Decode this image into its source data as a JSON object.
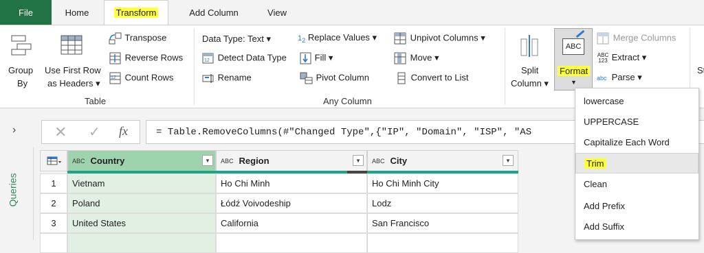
{
  "tabs": {
    "file": "File",
    "home": "Home",
    "transform": "Transform",
    "add_column": "Add Column",
    "view": "View"
  },
  "ribbon": {
    "table": {
      "group_by": [
        "Group",
        "By"
      ],
      "use_first_row": [
        "Use First Row",
        "as Headers"
      ],
      "transpose": "Transpose",
      "reverse_rows": "Reverse Rows",
      "count_rows": "Count Rows",
      "label": "Table"
    },
    "any_column": {
      "data_type": "Data Type: Text",
      "detect_data_type": "Detect Data Type",
      "rename": "Rename",
      "replace_values": "Replace Values",
      "fill": "Fill",
      "pivot_column": "Pivot Column",
      "unpivot_columns": "Unpivot Columns",
      "move": "Move",
      "convert_to_list": "Convert to List",
      "label": "Any Column"
    },
    "text_column": {
      "split_column": [
        "Split",
        "Column"
      ],
      "format": "Format",
      "format_icon_text": "ABC",
      "merge_columns": "Merge Columns",
      "extract": "Extract",
      "extract_icon_text": [
        "ABC",
        "123"
      ],
      "parse": "Parse",
      "parse_icon_text": "abc",
      "cut_off": "St"
    },
    "replace_sub": [
      "1",
      "2"
    ]
  },
  "queries_label": "Queries",
  "formula": {
    "fx": "fx",
    "expression": "= Table.RemoveColumns(#\"Changed Type\",{\"IP\", \"Domain\", \"ISP\", \"AS"
  },
  "grid": {
    "type_icon": "ABC",
    "columns": [
      "Country",
      "Region",
      "City"
    ],
    "rows": [
      {
        "num": "1",
        "cells": [
          "Vietnam",
          "Ho Chi Minh",
          "Ho Chi Minh City"
        ]
      },
      {
        "num": "2",
        "cells": [
          "Poland",
          "Łódź Voivodeship",
          "Lodz"
        ]
      },
      {
        "num": "3",
        "cells": [
          "United States",
          "California",
          "San Francisco"
        ]
      }
    ]
  },
  "format_menu": [
    "lowercase",
    "UPPERCASE",
    "Capitalize Each Word",
    "Trim",
    "Clean",
    "Add Prefix",
    "Add Suffix"
  ],
  "colors": {
    "file_tab": "#217346",
    "highlight": "#ffff3c",
    "selected_column": "#e2f0e4",
    "accent_bar": "#1aa589"
  }
}
